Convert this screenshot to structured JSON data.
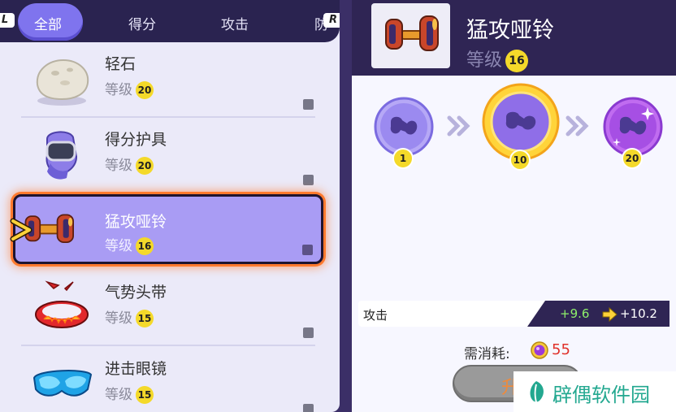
{
  "tabs": {
    "left_shoulder": "L",
    "right_shoulder": "R",
    "items": [
      {
        "label": "全部",
        "active": true
      },
      {
        "label": "得分",
        "active": false
      },
      {
        "label": "攻击",
        "active": false
      },
      {
        "label": "防",
        "active": false
      }
    ]
  },
  "items": [
    {
      "name": "轻石",
      "level_label": "等级",
      "level": "20",
      "icon": "float-stone-icon",
      "selected": false
    },
    {
      "name": "得分护具",
      "level_label": "等级",
      "level": "20",
      "icon": "score-shield-icon",
      "selected": false
    },
    {
      "name": "猛攻哑铃",
      "level_label": "等级",
      "level": "16",
      "icon": "muscle-band-dumbbell-icon",
      "selected": true
    },
    {
      "name": "气势头带",
      "level_label": "等级",
      "level": "15",
      "icon": "focus-band-icon",
      "selected": false
    },
    {
      "name": "进击眼镜",
      "level_label": "等级",
      "level": "15",
      "icon": "attack-goggles-icon",
      "selected": false
    }
  ],
  "detail": {
    "title": "猛攻哑铃",
    "level_label": "等级",
    "level": "16",
    "stages": [
      {
        "level": "1",
        "state": "unlocked"
      },
      {
        "level": "10",
        "state": "current"
      },
      {
        "level": "20",
        "state": "locked"
      }
    ],
    "stat": {
      "label": "攻击",
      "current": "+9.6",
      "next": "+10.2"
    },
    "cost_label": "需消耗:",
    "cost_value": "55",
    "upgrade_label": "升"
  },
  "colors": {
    "accent_purple": "#7f74ee",
    "selected_row": "#a99cf4",
    "selected_glow": "#ff7a2e",
    "level_badge": "#f4d92a",
    "dark_header": "#2f2554",
    "stat_increase": "#8ef06a",
    "cost_red": "#e0312a"
  },
  "watermark": {
    "text": "辟偶软件园"
  }
}
